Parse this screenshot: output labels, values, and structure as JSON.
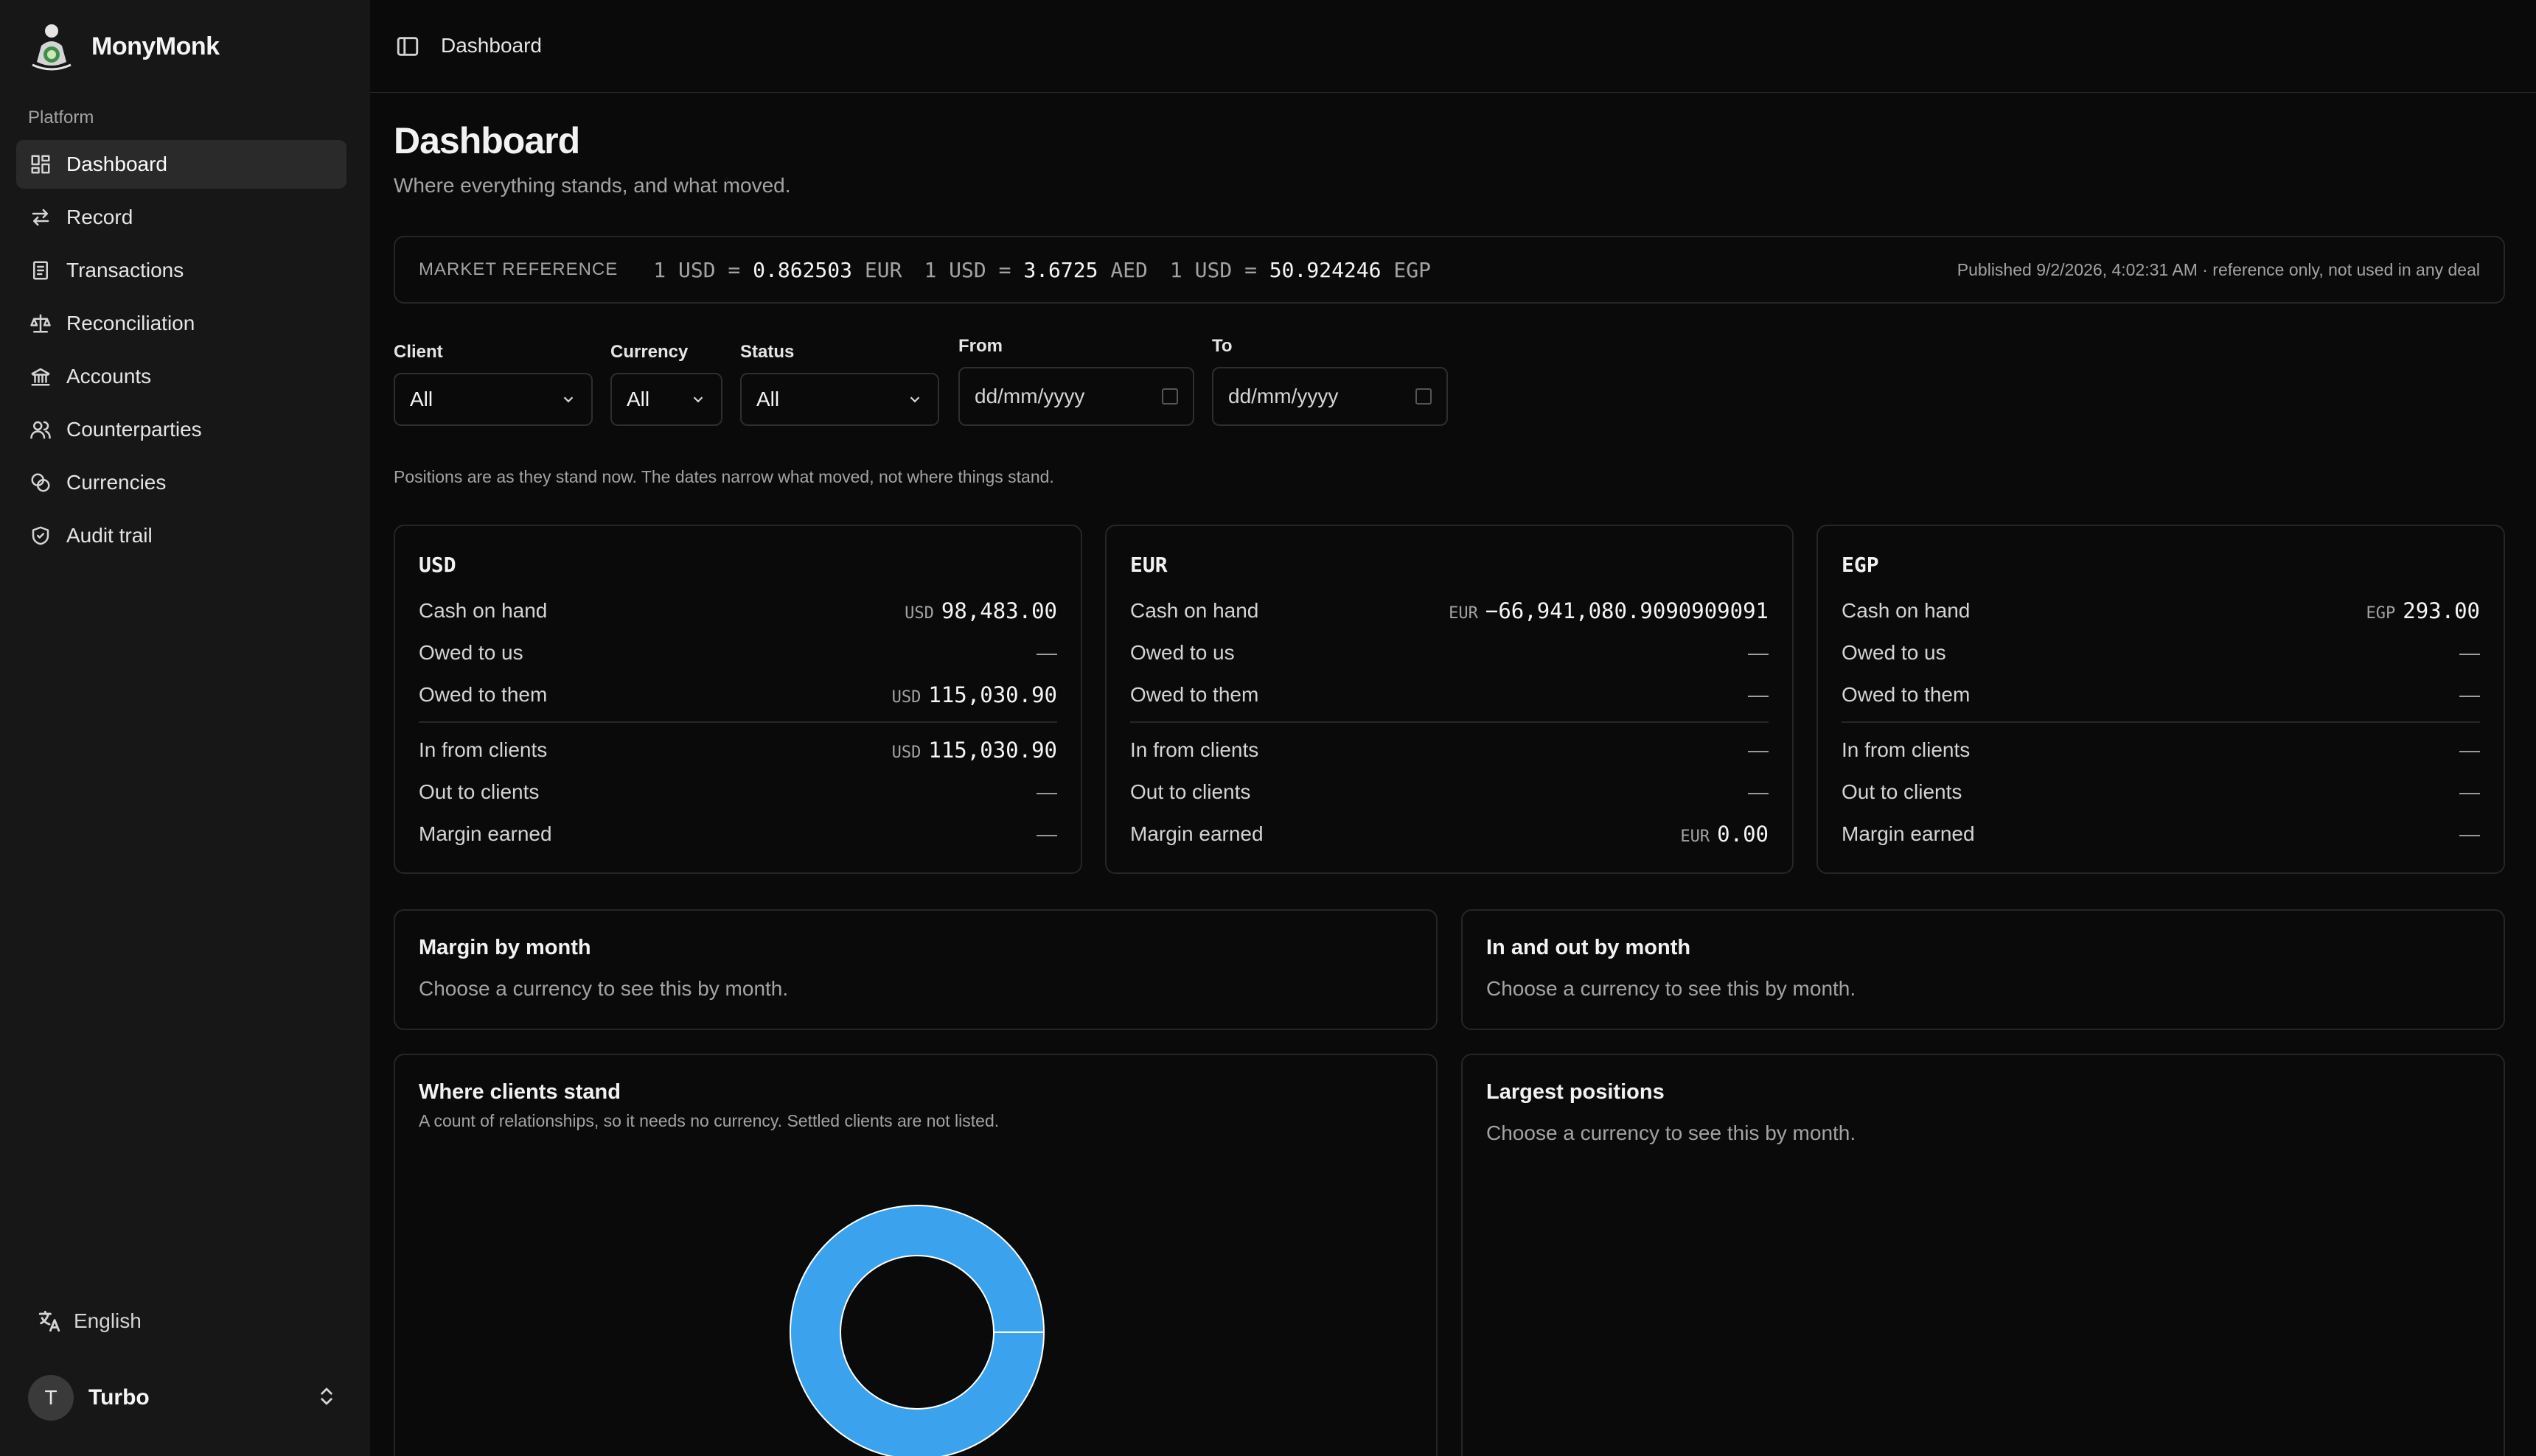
{
  "brand": {
    "name": "MonyMonk"
  },
  "sidebar": {
    "group_label": "Platform",
    "items": [
      {
        "label": "Dashboard",
        "icon": "dashboard-icon",
        "active": true
      },
      {
        "label": "Record",
        "icon": "arrows-icon"
      },
      {
        "label": "Transactions",
        "icon": "receipt-icon"
      },
      {
        "label": "Reconciliation",
        "icon": "scale-icon"
      },
      {
        "label": "Accounts",
        "icon": "bank-icon"
      },
      {
        "label": "Counterparties",
        "icon": "users-icon"
      },
      {
        "label": "Currencies",
        "icon": "coins-icon"
      },
      {
        "label": "Audit trail",
        "icon": "shield-icon"
      }
    ],
    "language": "English",
    "user": {
      "initial": "T",
      "name": "Turbo"
    }
  },
  "header": {
    "breadcrumb": "Dashboard"
  },
  "page": {
    "title": "Dashboard",
    "subtitle": "Where everything stands, and what moved."
  },
  "market": {
    "label": "MARKET REFERENCE",
    "rates": [
      {
        "base": "1 USD",
        "eq": "=",
        "value": "0.862503",
        "quote": "EUR"
      },
      {
        "base": "1 USD",
        "eq": "=",
        "value": "3.6725",
        "quote": "AED"
      },
      {
        "base": "1 USD",
        "eq": "=",
        "value": "50.924246",
        "quote": "EGP"
      }
    ],
    "published": "Published 9/2/2026, 4:02:31 AM · reference only, not used in any deal"
  },
  "filters": {
    "client": {
      "label": "Client",
      "value": "All"
    },
    "currency": {
      "label": "Currency",
      "value": "All"
    },
    "status": {
      "label": "Status",
      "value": "All"
    },
    "from": {
      "label": "From",
      "placeholder": "dd/mm/yyyy"
    },
    "to": {
      "label": "To",
      "placeholder": "dd/mm/yyyy"
    }
  },
  "note": "Positions are as they stand now. The dates narrow what moved, not where things stand.",
  "cards": [
    {
      "title": "USD",
      "rows": [
        {
          "label": "Cash on hand",
          "cur": "USD",
          "value": "98,483.00"
        },
        {
          "label": "Owed to us",
          "cur": "",
          "value": "—"
        },
        {
          "label": "Owed to them",
          "cur": "USD",
          "value": "115,030.90"
        },
        {
          "label": "In from clients",
          "cur": "USD",
          "value": "115,030.90"
        },
        {
          "label": "Out to clients",
          "cur": "",
          "value": "—"
        },
        {
          "label": "Margin earned",
          "cur": "",
          "value": "—"
        }
      ]
    },
    {
      "title": "EUR",
      "rows": [
        {
          "label": "Cash on hand",
          "cur": "EUR",
          "value": "−66,941,080.9090909091"
        },
        {
          "label": "Owed to us",
          "cur": "",
          "value": "—"
        },
        {
          "label": "Owed to them",
          "cur": "",
          "value": "—"
        },
        {
          "label": "In from clients",
          "cur": "",
          "value": "—"
        },
        {
          "label": "Out to clients",
          "cur": "",
          "value": "—"
        },
        {
          "label": "Margin earned",
          "cur": "EUR",
          "value": "0.00"
        }
      ]
    },
    {
      "title": "EGP",
      "rows": [
        {
          "label": "Cash on hand",
          "cur": "EGP",
          "value": "293.00"
        },
        {
          "label": "Owed to us",
          "cur": "",
          "value": "—"
        },
        {
          "label": "Owed to them",
          "cur": "",
          "value": "—"
        },
        {
          "label": "In from clients",
          "cur": "",
          "value": "—"
        },
        {
          "label": "Out to clients",
          "cur": "",
          "value": "—"
        },
        {
          "label": "Margin earned",
          "cur": "",
          "value": "—"
        }
      ]
    }
  ],
  "panels": {
    "margin_by_month": {
      "title": "Margin by month",
      "message": "Choose a currency to see this by month."
    },
    "in_out_by_month": {
      "title": "In and out by month",
      "message": "Choose a currency to see this by month."
    },
    "where_clients_stand": {
      "title": "Where clients stand",
      "note": "A count of relationships, so it needs no currency. Settled clients are not listed."
    },
    "largest_positions": {
      "title": "Largest positions",
      "message": "Choose a currency to see this by month."
    }
  },
  "chart_data": {
    "type": "pie",
    "title": "Where clients stand",
    "slices": [
      {
        "value": 1,
        "color": "#3ba3ee"
      }
    ]
  }
}
